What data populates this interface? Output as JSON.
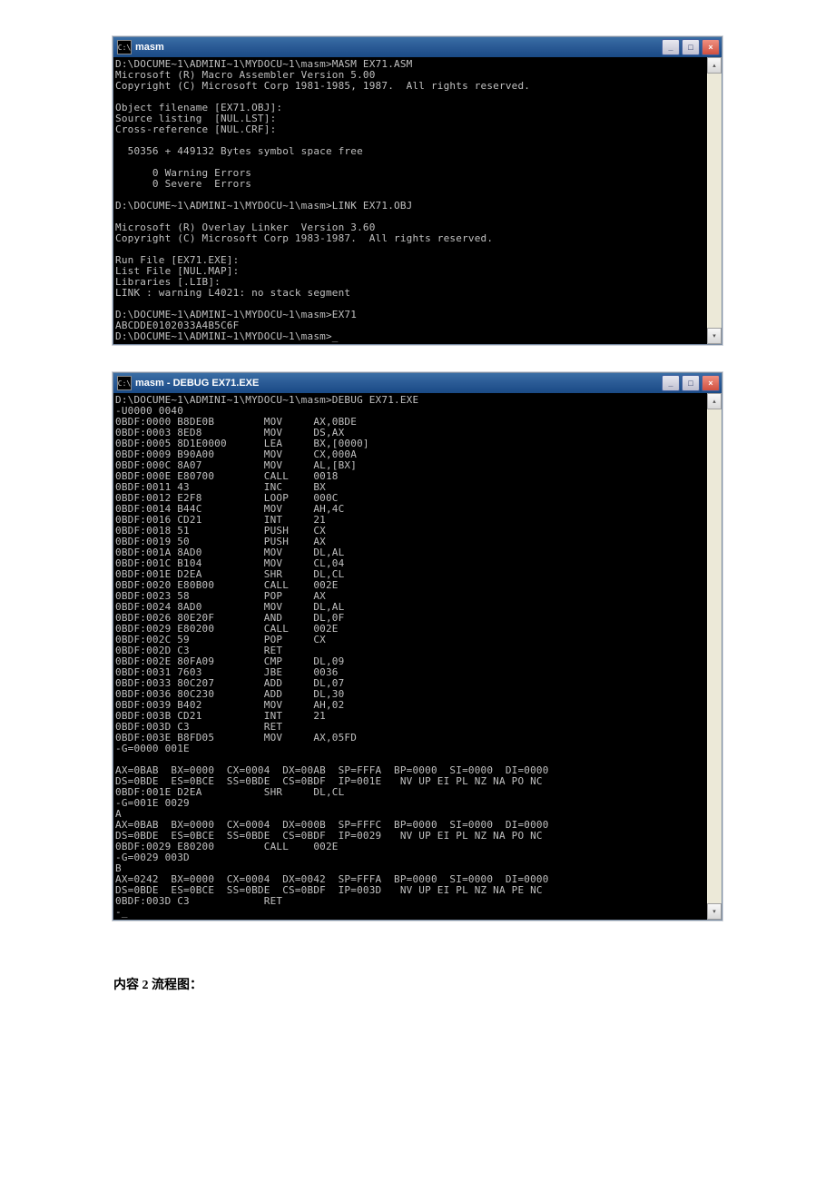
{
  "window1": {
    "title": "masm",
    "icon_label": "C:\\",
    "lines": [
      "D:\\DOCUME~1\\ADMINI~1\\MYDOCU~1\\masm>MASM EX71.ASM",
      "Microsoft (R) Macro Assembler Version 5.00",
      "Copyright (C) Microsoft Corp 1981-1985, 1987.  All rights reserved.",
      "",
      "Object filename [EX71.OBJ]:",
      "Source listing  [NUL.LST]:",
      "Cross-reference [NUL.CRF]:",
      "",
      "  50356 + 449132 Bytes symbol space free",
      "",
      "      0 Warning Errors",
      "      0 Severe  Errors",
      "",
      "D:\\DOCUME~1\\ADMINI~1\\MYDOCU~1\\masm>LINK EX71.OBJ",
      "",
      "Microsoft (R) Overlay Linker  Version 3.60",
      "Copyright (C) Microsoft Corp 1983-1987.  All rights reserved.",
      "",
      "Run File [EX71.EXE]:",
      "List File [NUL.MAP]:",
      "Libraries [.LIB]:",
      "LINK : warning L4021: no stack segment",
      "",
      "D:\\DOCUME~1\\ADMINI~1\\MYDOCU~1\\masm>EX71",
      "ABCDDE0102033A4B5C6F",
      "D:\\DOCUME~1\\ADMINI~1\\MYDOCU~1\\masm>_"
    ]
  },
  "window2": {
    "title": "masm - DEBUG EX71.EXE",
    "icon_label": "C:\\",
    "lines": [
      "D:\\DOCUME~1\\ADMINI~1\\MYDOCU~1\\masm>DEBUG EX71.EXE",
      "-U0000 0040",
      "0BDF:0000 B8DE0B        MOV     AX,0BDE",
      "0BDF:0003 8ED8          MOV     DS,AX",
      "0BDF:0005 8D1E0000      LEA     BX,[0000]",
      "0BDF:0009 B90A00        MOV     CX,000A",
      "0BDF:000C 8A07          MOV     AL,[BX]",
      "0BDF:000E E80700        CALL    0018",
      "0BDF:0011 43            INC     BX",
      "0BDF:0012 E2F8          LOOP    000C",
      "0BDF:0014 B44C          MOV     AH,4C",
      "0BDF:0016 CD21          INT     21",
      "0BDF:0018 51            PUSH    CX",
      "0BDF:0019 50            PUSH    AX",
      "0BDF:001A 8AD0          MOV     DL,AL",
      "0BDF:001C B104          MOV     CL,04",
      "0BDF:001E D2EA          SHR     DL,CL",
      "0BDF:0020 E80B00        CALL    002E",
      "0BDF:0023 58            POP     AX",
      "0BDF:0024 8AD0          MOV     DL,AL",
      "0BDF:0026 80E20F        AND     DL,0F",
      "0BDF:0029 E80200        CALL    002E",
      "0BDF:002C 59            POP     CX",
      "0BDF:002D C3            RET",
      "0BDF:002E 80FA09        CMP     DL,09",
      "0BDF:0031 7603          JBE     0036",
      "0BDF:0033 80C207        ADD     DL,07",
      "0BDF:0036 80C230        ADD     DL,30",
      "0BDF:0039 B402          MOV     AH,02",
      "0BDF:003B CD21          INT     21",
      "0BDF:003D C3            RET",
      "0BDF:003E B8FD05        MOV     AX,05FD",
      "-G=0000 001E",
      "",
      "AX=0BAB  BX=0000  CX=0004  DX=00AB  SP=FFFA  BP=0000  SI=0000  DI=0000",
      "DS=0BDE  ES=0BCE  SS=0BDE  CS=0BDF  IP=001E   NV UP EI PL NZ NA PO NC",
      "0BDF:001E D2EA          SHR     DL,CL",
      "-G=001E 0029",
      "A",
      "AX=0BAB  BX=0000  CX=0004  DX=000B  SP=FFFC  BP=0000  SI=0000  DI=0000",
      "DS=0BDE  ES=0BCE  SS=0BDE  CS=0BDF  IP=0029   NV UP EI PL NZ NA PO NC",
      "0BDF:0029 E80200        CALL    002E",
      "-G=0029 003D",
      "B",
      "AX=0242  BX=0000  CX=0004  DX=0042  SP=FFFA  BP=0000  SI=0000  DI=0000",
      "DS=0BDE  ES=0BCE  SS=0BDE  CS=0BDF  IP=003D   NV UP EI PL NZ NA PE NC",
      "0BDF:003D C3            RET",
      "-_"
    ]
  },
  "buttons": {
    "minimize": "_",
    "maximize": "□",
    "close": "×"
  },
  "scroll": {
    "up": "▴",
    "down": "▾"
  },
  "caption": "内容 2 流程图："
}
